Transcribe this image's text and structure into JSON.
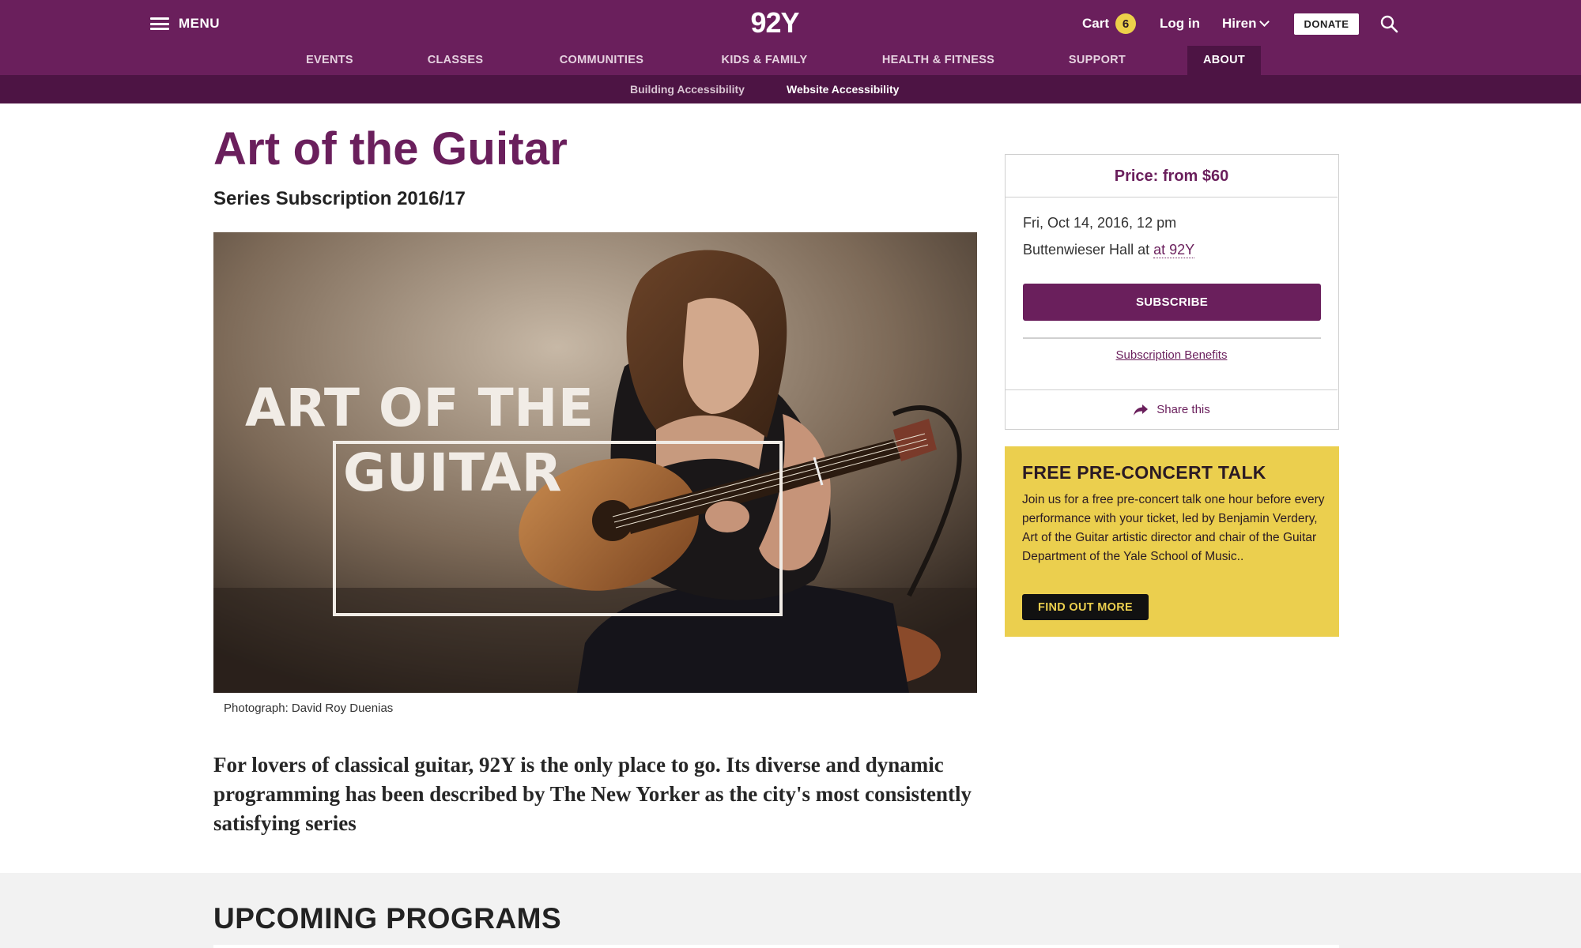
{
  "header": {
    "menu_label": "MENU",
    "logo_text": "92Y",
    "cart_label": "Cart",
    "cart_count": "6",
    "login_label": "Log in",
    "user_name": "Hiren",
    "donate_label": "DONATE"
  },
  "main_nav": {
    "items": [
      {
        "label": "EVENTS",
        "active": false
      },
      {
        "label": "CLASSES",
        "active": false
      },
      {
        "label": "COMMUNITIES",
        "active": false
      },
      {
        "label": "KIDS & FAMILY",
        "active": false
      },
      {
        "label": "HEALTH & FITNESS",
        "active": false
      },
      {
        "label": "SUPPORT",
        "active": false
      },
      {
        "label": "ABOUT",
        "active": true
      }
    ]
  },
  "sub_nav": {
    "items": [
      {
        "label": "Building Accessibility",
        "active": false
      },
      {
        "label": "Website Accessibility",
        "active": true
      }
    ]
  },
  "page": {
    "title": "Art of the Guitar",
    "subtitle": "Series Subscription 2016/17",
    "hero_line1": "ART OF THE",
    "hero_line2": "GUITAR",
    "caption": "Photograph: David Roy Duenias",
    "lead": "For lovers of classical guitar, 92Y is the only place to go. Its diverse and dynamic programming has been described by The New Yorker as the city's most consistently satisfying series"
  },
  "ticket_card": {
    "price": "Price: from $60",
    "date": "Fri, Oct 14, 2016, 12 pm",
    "venue_prefix": "Buttenwieser Hall at ",
    "venue_link": "at 92Y",
    "subscribe_label": "SUBSCRIBE",
    "benefits_label": "Subscription Benefits",
    "share_label": "Share this"
  },
  "promo": {
    "title": "FREE PRE-CONCERT TALK",
    "body": "Join us for a free pre-concert talk one hour before every performance with your ticket, led by Benjamin Verdery, Art of the Guitar artistic director and chair of the Guitar Department of the Yale School of Music..",
    "button_label": "FIND OUT MORE"
  },
  "upcoming": {
    "title": "UPCOMING PROGRAMS"
  },
  "colors": {
    "brand_purple": "#6a1f5c",
    "dark_purple": "#4d1444",
    "promo_yellow": "#ebcf4e"
  },
  "icons": [
    "hamburger-menu-icon",
    "chevron-down-icon",
    "search-icon",
    "share-arrow-icon"
  ]
}
